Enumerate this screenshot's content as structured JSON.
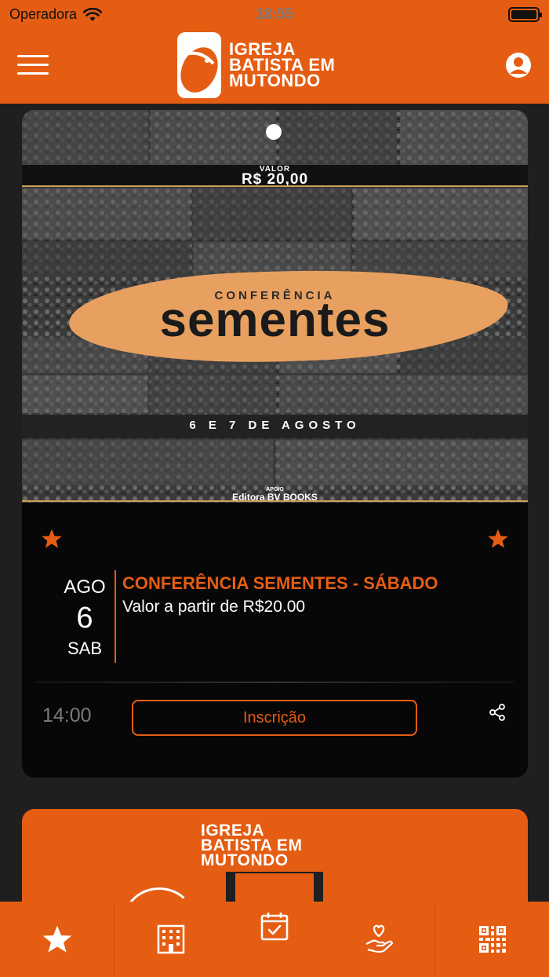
{
  "status_bar": {
    "carrier": "Operadora",
    "time": "18:55"
  },
  "header": {
    "logo_line1": "IGREJA",
    "logo_line2": "BATISTA EM",
    "logo_line3": "MUTONDO"
  },
  "event": {
    "poster": {
      "valor_label": "VALOR",
      "valor": "R$ 20,00",
      "conference_label": "CONFERÊNCIA",
      "name": "sementes",
      "dates": "6 E 7 DE AGOSTO",
      "apoio_label": "APOIO",
      "apoio": "Editora BV BOOKS"
    },
    "month": "AGO",
    "day": "6",
    "weekday": "SAB",
    "title": "CONFERÊNCIA SEMENTES - SÁBADO",
    "subtitle": "Valor a partir de R$20.00",
    "time": "14:00",
    "button_label": "Inscrição"
  },
  "next_card": {
    "logo_line1": "IGREJA",
    "logo_line2": "BATISTA EM",
    "logo_line3": "MUTONDO"
  },
  "tabbar": {
    "tabs": [
      "star-icon",
      "building-icon",
      "calendar-check-icon",
      "hand-heart-icon",
      "qr-code-icon"
    ],
    "active_tab": "calendar-check-icon"
  },
  "colors": {
    "accent": "#e55d12",
    "card_bg": "#070707",
    "page_bg": "#1f1f1f"
  }
}
